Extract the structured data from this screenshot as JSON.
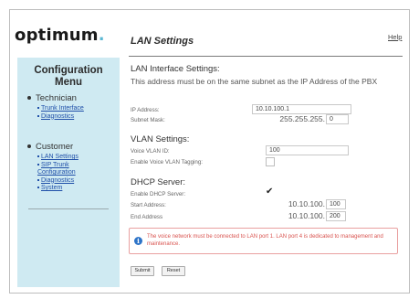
{
  "logo": {
    "text": "optimum",
    "dot": "."
  },
  "sidebar": {
    "title_line1": "Configuration",
    "title_line2": "Menu",
    "sections": [
      {
        "label": "Technician",
        "links": [
          "Trunk Interface",
          "Diagnostics"
        ]
      },
      {
        "label": "Customer",
        "links": [
          "LAN Settings",
          "SIP Trunk Configuration",
          "Diagnostics",
          "System"
        ]
      }
    ]
  },
  "header": {
    "title": "LAN Settings",
    "help": "Help"
  },
  "lan": {
    "heading": "LAN Interface Settings:",
    "description": "This address must be on the same subnet as the IP Address of the PBX",
    "ip_label": "IP Address:",
    "ip_value": "10.10.100.1",
    "mask_label": "Subnet Mask:",
    "mask_prefix": "255.255.255.",
    "mask_value": "0"
  },
  "vlan": {
    "heading": "VLAN Settings:",
    "voice_id_label": "Voice VLAN ID:",
    "voice_id_value": "100",
    "tagging_label": "Enable Voice VLAN Tagging:",
    "tagging_checked": false
  },
  "dhcp": {
    "heading": "DHCP Server:",
    "enable_label": "Enable DHCP Server:",
    "enable_checked": true,
    "start_label": "Start Address:",
    "start_prefix": "10.10.100.",
    "start_value": "100",
    "end_label": "End Address",
    "end_prefix": "10.10.100.",
    "end_value": "200"
  },
  "notice": {
    "text": "The voice network must be connected to LAN port 1. LAN port 4 is dedicated to management and maintenance."
  },
  "buttons": {
    "submit": "Submit",
    "reset": "Reset"
  },
  "colors": {
    "accent": "#5bb8d3",
    "sidebar_bg": "#cfeaf2",
    "link": "#1f4fa8",
    "warning": "#d9534f"
  },
  "icons": {
    "info": "info-icon",
    "check": "checkmark-icon"
  }
}
